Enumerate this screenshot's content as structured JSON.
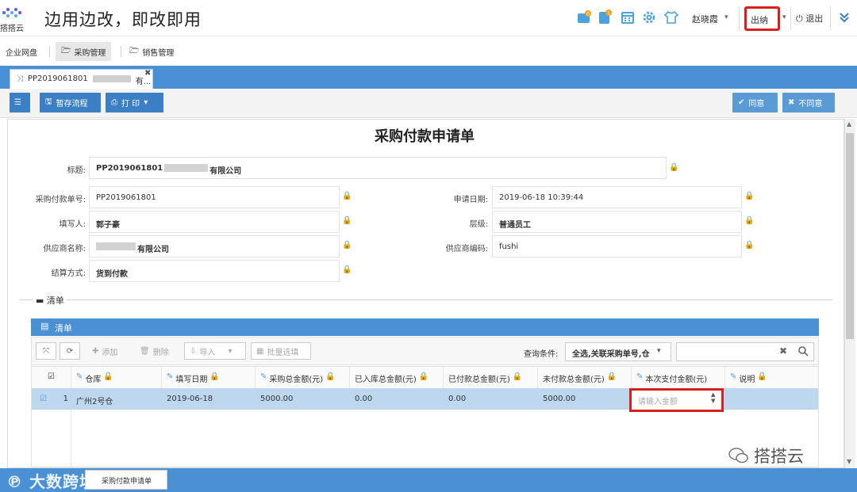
{
  "header": {
    "logo_text": "搭搭云",
    "slogan": "边用边改，即改即用",
    "notification_badge_1": "0",
    "notification_badge_2": "1",
    "user_name": "赵晓霞",
    "role": "出纳",
    "logout_label": "退出"
  },
  "nav": {
    "tabs": [
      {
        "label": "企业网盘"
      },
      {
        "label": "采购管理"
      },
      {
        "label": "销售管理"
      }
    ]
  },
  "doc_tab": {
    "label": "PP2019061801",
    "label_tail": "有..."
  },
  "toolbar": {
    "save_flow": "暂存流程",
    "print": "打 印",
    "agree": "同意",
    "disagree": "不同意"
  },
  "form": {
    "title": "采购付款申请单",
    "fields": {
      "subject_label": "标题:",
      "subject_prefix": "PP2019061801",
      "subject_suffix": "有限公司",
      "order_no_label": "采购付款单号:",
      "order_no": "PP2019061801",
      "apply_date_label": "申请日期:",
      "apply_date": "2019-06-18 10:39:44",
      "filler_label": "填写人:",
      "filler": "郭子豪",
      "level_label": "层级:",
      "level": "普通员工",
      "supplier_name_label": "供应商名称:",
      "supplier_name_suffix": "有限公司",
      "supplier_code_label": "供应商编码:",
      "supplier_code": "fushi",
      "settlement_label": "结算方式:",
      "settlement": "货到付款"
    }
  },
  "list": {
    "legend": "清单",
    "header": "清单",
    "toolbar": {
      "add": "添加",
      "delete": "删除",
      "import": "导入",
      "batch_select": "批量选填",
      "query_label": "查询条件:",
      "query_value": "全选,关联采购单号,仓"
    },
    "columns": [
      {
        "label": "仓库"
      },
      {
        "label": "填写日期"
      },
      {
        "label": "采购总金额(元)"
      },
      {
        "label": "已入库总金额(元)"
      },
      {
        "label": "已付款总金额(元)"
      },
      {
        "label": "未付款总金额(元)"
      },
      {
        "label": "本次支付金额(元)"
      },
      {
        "label": "说明"
      }
    ],
    "rows": [
      {
        "index": "1",
        "warehouse": "广州2号仓",
        "date": "2019-06-18",
        "purchase_total": "5000.00",
        "stocked_total": "0.00",
        "paid_total": "0.00",
        "unpaid_total": "5000.00",
        "pay_placeholder": "请输入金额",
        "remark": ""
      }
    ]
  },
  "bottom": {
    "tab_label": "采购付款申请单",
    "watermark_left": "大数跨境",
    "watermark_right": "搭搭云"
  },
  "colors": {
    "primary": "#4a90d4",
    "button": "#3b7fc4",
    "highlight_border": "#d9201c",
    "selected_row": "#bcd7ee"
  }
}
